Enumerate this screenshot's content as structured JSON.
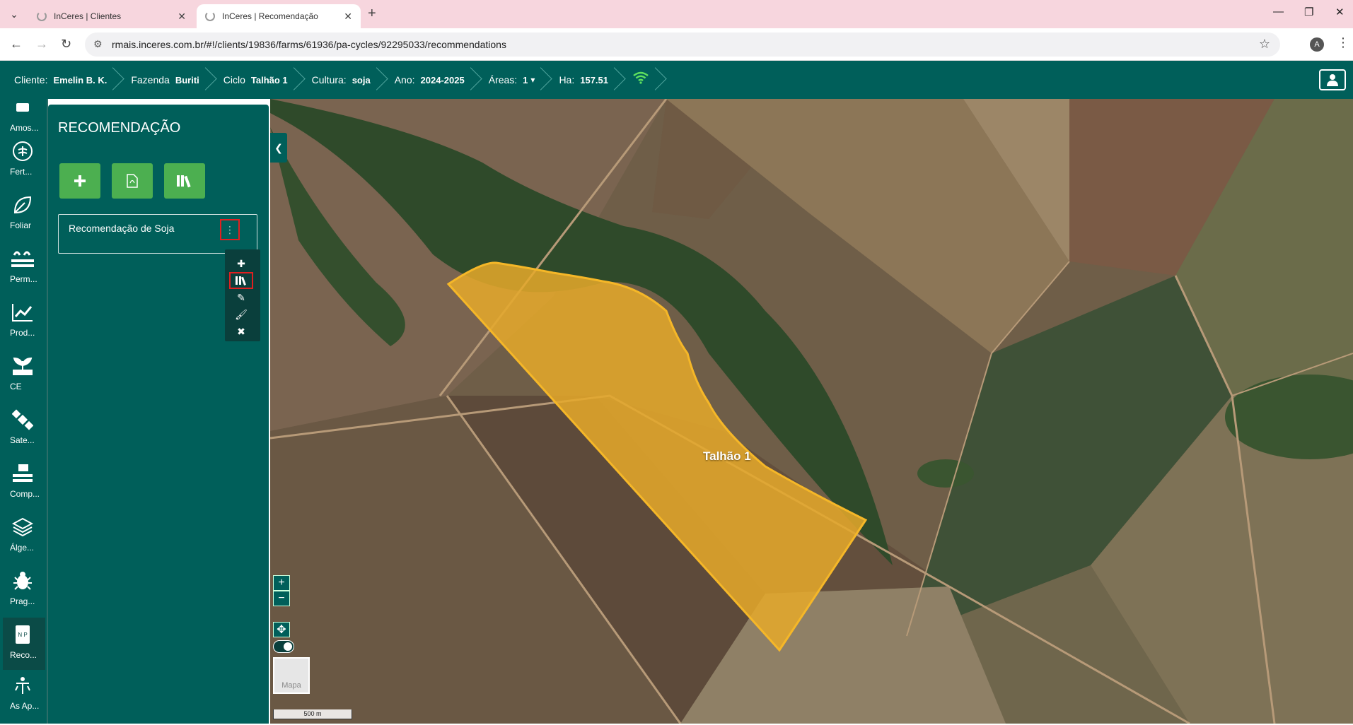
{
  "browser": {
    "tabs": [
      {
        "title": "InCeres | Clientes"
      },
      {
        "title": "InCeres | Recomendação"
      }
    ],
    "url": "rmais.inceres.com.br/#!/clients/19836/farms/61936/pa-cycles/92295033/recommendations",
    "profile_initial": "A"
  },
  "header": {
    "cliente_label": "Cliente:",
    "cliente_value": "Emelin B. K.",
    "fazenda_label": "Fazenda",
    "fazenda_value": "Buriti",
    "ciclo_label": "Ciclo",
    "ciclo_value": "Talhão 1",
    "cultura_label": "Cultura:",
    "cultura_value": "soja",
    "ano_label": "Ano:",
    "ano_value": "2024-2025",
    "areas_label": "Áreas:",
    "areas_value": "1",
    "ha_label": "Ha:",
    "ha_value": "157.51"
  },
  "rail": [
    {
      "label": "Amos...",
      "icon": "sample-icon"
    },
    {
      "label": "Fert...",
      "icon": "fertility-icon"
    },
    {
      "label": "Foliar",
      "icon": "leaf-icon"
    },
    {
      "label": "Perm...",
      "icon": "permeability-icon"
    },
    {
      "label": "Prod...",
      "icon": "productivity-chart-icon"
    },
    {
      "label": "CE",
      "icon": "plant-ce-icon"
    },
    {
      "label": "Sate...",
      "icon": "satellite-icon"
    },
    {
      "label": "Comp...",
      "icon": "compaction-icon"
    },
    {
      "label": "Álge...",
      "icon": "layers-icon"
    },
    {
      "label": "Prag...",
      "icon": "bug-icon"
    },
    {
      "label": "Reco...",
      "icon": "recommendation-icon"
    },
    {
      "label": "As Ap...",
      "icon": "application-icon"
    }
  ],
  "panel": {
    "title": "RECOMENDAÇÃO",
    "recommendation_name": "Recomendação de Soja"
  },
  "map": {
    "field_label": "Talhão 1",
    "basemap_label": "Mapa",
    "scale_label": "500 m",
    "zoom_in": "+",
    "zoom_out": "−"
  },
  "colors": {
    "brand": "#005f5a",
    "action_green": "#4caf50",
    "highlight_red": "#e02020",
    "field_fill": "#e6a92a"
  }
}
